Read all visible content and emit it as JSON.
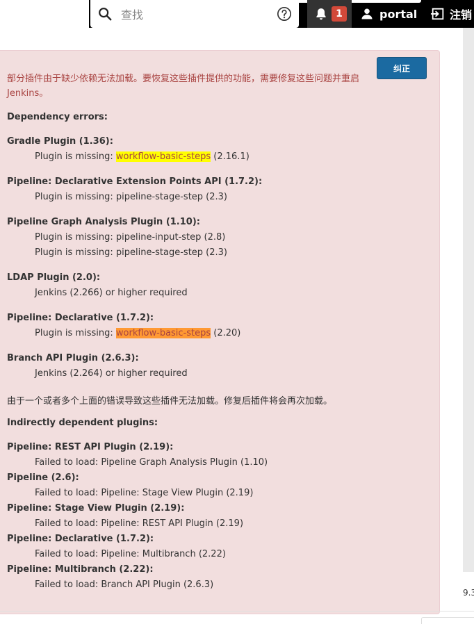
{
  "header": {
    "search": {
      "placeholder": "查找",
      "value": ""
    },
    "notifications": {
      "count": "1"
    },
    "user": {
      "name": "portal"
    },
    "logout": {
      "label": "注销"
    }
  },
  "alert": {
    "fix_button": "纠正",
    "intro": "部分插件由于缺少依赖无法加载。要恢复这些插件提供的功能，需要修复这些问题并重启 Jenkins。",
    "dependency_errors_title": "Dependency errors:",
    "plugins": [
      {
        "name": "Gradle Plugin (1.36):",
        "issues": [
          {
            "prefix": "Plugin is missing: ",
            "highlight": "workflow-basic-steps",
            "suffix": " (2.16.1)"
          }
        ]
      },
      {
        "name": "Pipeline: Declarative Extension Points API (1.7.2):",
        "issues": [
          {
            "text": "Plugin is missing: pipeline-stage-step (2.3)"
          }
        ]
      },
      {
        "name": "Pipeline Graph Analysis Plugin (1.10):",
        "issues": [
          {
            "text": "Plugin is missing: pipeline-input-step (2.8)"
          },
          {
            "text": "Plugin is missing: pipeline-stage-step (2.3)"
          }
        ]
      },
      {
        "name": "LDAP Plugin (2.0):",
        "issues": [
          {
            "text": "Jenkins (2.266) or higher required"
          }
        ]
      },
      {
        "name": "Pipeline: Declarative (1.7.2):",
        "issues": [
          {
            "prefix": "Plugin is missing: ",
            "highlight": "workflow-basic-steps",
            "suffix": " (2.20)"
          }
        ]
      },
      {
        "name": "Branch API Plugin (2.6.3):",
        "issues": [
          {
            "text": "Jenkins (2.264) or higher required"
          }
        ]
      }
    ],
    "reload_note": "由于一个或者多个上面的错误导致这些插件无法加载。修复后插件将会再次加载。",
    "indirect_title": "Indirectly dependent plugins:",
    "indirect": [
      {
        "name": "Pipeline: REST API Plugin (2.19):",
        "text": "Failed to load: Pipeline Graph Analysis Plugin (1.10)"
      },
      {
        "name": "Pipeline (2.6):",
        "text": "Failed to load: Pipeline: Stage View Plugin (2.19)"
      },
      {
        "name": "Pipeline: Stage View Plugin (2.19):",
        "text": "Failed to load: Pipeline: REST API Plugin (2.19)"
      },
      {
        "name": "Pipeline: Declarative (1.7.2):",
        "text": "Failed to load: Pipeline: Multibranch (2.22)"
      },
      {
        "name": "Pipeline: Multibranch (2.22):",
        "text": "Failed to load: Branch API Plugin (2.6.3)"
      }
    ]
  },
  "footer": {
    "version_fragment": "9.3"
  },
  "colors": {
    "alert_bg": "#f2dede",
    "alert_text": "#a94442",
    "button_bg": "#1b6aa1",
    "badge_bg": "#d24939",
    "highlight_yellow": "#ffff00",
    "highlight_orange": "#ff9933"
  },
  "icons": [
    "search-icon",
    "help-icon",
    "bell-icon",
    "user-icon",
    "logout-icon"
  ]
}
